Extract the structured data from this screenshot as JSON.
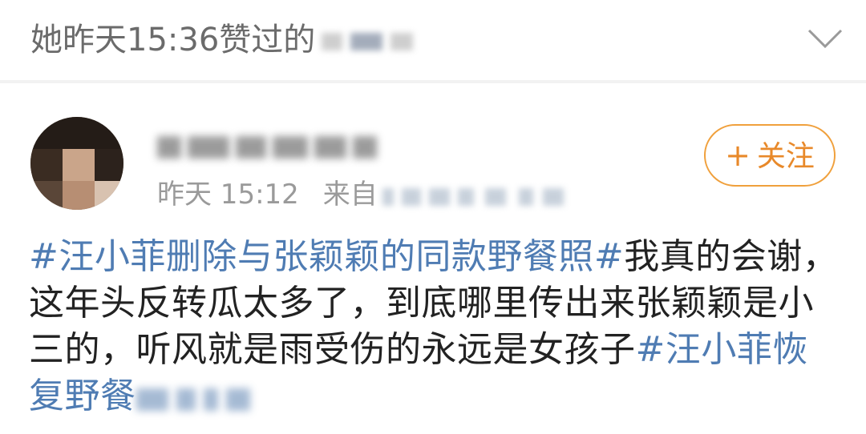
{
  "liked_bar": {
    "text": "她昨天15:36赞过的",
    "redacted": "blurred author name",
    "chevron_icon": "chevron-down-icon"
  },
  "post": {
    "author": {
      "name": "",
      "name_redacted": true,
      "avatar_redacted": true
    },
    "time": "昨天 15:12",
    "source_prefix": "来自",
    "source_redacted": true,
    "follow_button": {
      "label": "关注",
      "icon": "plus-icon",
      "color": "#e8892a"
    },
    "content": {
      "tag1": "#汪小菲删除与张颖颖的同款野餐照#",
      "text1": "我真的会谢，",
      "line2": "这年头反转瓜太多了，到底哪里传出来张颖颖是小",
      "line3_text": "三的，听风就是雨受伤的永远是女孩子",
      "tag2_part1": "#汪小菲恢",
      "tag2_part2": "复野餐",
      "tag2_redacted_tail": true
    },
    "colors": {
      "tag": "#4f7cb3",
      "text": "#222222",
      "meta": "#9a9a9a"
    }
  }
}
